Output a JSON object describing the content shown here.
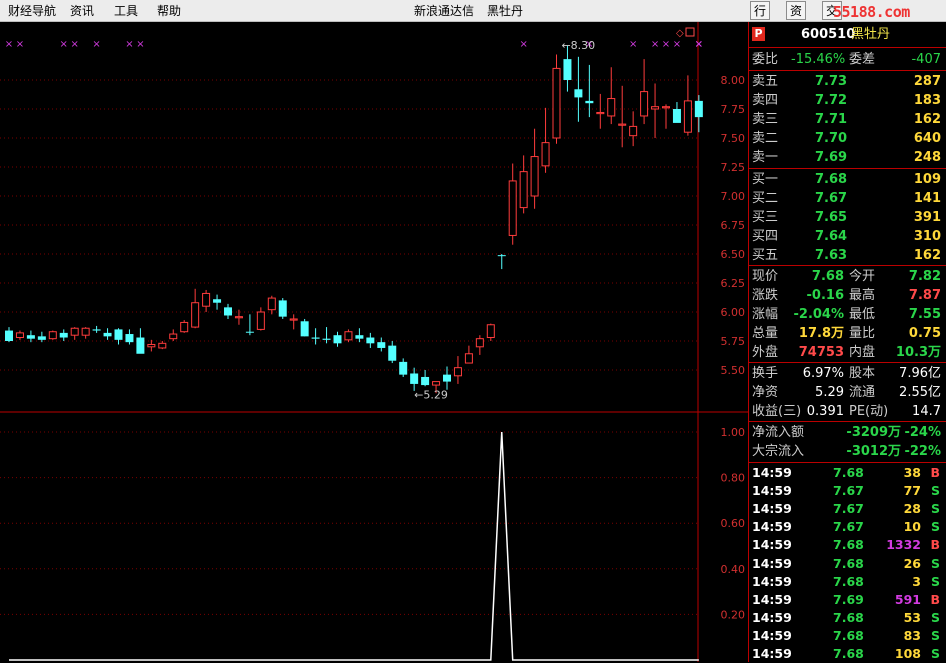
{
  "menu": {
    "items": [
      "财经导航",
      "资讯",
      "工具",
      "帮助"
    ],
    "title": "新浪通达信",
    "stock_name": "黑牡丹"
  },
  "tabs": [
    "行情",
    "资讯",
    "交易"
  ],
  "watermark": "55188.com",
  "panel": {
    "code": "600510",
    "name": "黑牡丹",
    "weibi": {
      "label": "委比",
      "value": "-15.46%",
      "label2": "委差",
      "value2": "-407"
    },
    "sells": [
      {
        "label": "卖五",
        "price": "7.73",
        "vol": "287"
      },
      {
        "label": "卖四",
        "price": "7.72",
        "vol": "183"
      },
      {
        "label": "卖三",
        "price": "7.71",
        "vol": "162"
      },
      {
        "label": "卖二",
        "price": "7.70",
        "vol": "640"
      },
      {
        "label": "卖一",
        "price": "7.69",
        "vol": "248"
      }
    ],
    "buys": [
      {
        "label": "买一",
        "price": "7.68",
        "vol": "109"
      },
      {
        "label": "买二",
        "price": "7.67",
        "vol": "141"
      },
      {
        "label": "买三",
        "price": "7.65",
        "vol": "391"
      },
      {
        "label": "买四",
        "price": "7.64",
        "vol": "310"
      },
      {
        "label": "买五",
        "price": "7.63",
        "vol": "162"
      }
    ],
    "quote": [
      {
        "l1": "现价",
        "v1": "7.68",
        "l2": "今开",
        "v2": "7.82"
      },
      {
        "l1": "涨跌",
        "v1": "-0.16",
        "l2": "最高",
        "v2": "7.87"
      },
      {
        "l1": "涨幅",
        "v1": "-2.04%",
        "l2": "最低",
        "v2": "7.55"
      },
      {
        "l1": "总量",
        "v1": "17.8万",
        "l2": "量比",
        "v2": "0.75"
      },
      {
        "l1": "外盘",
        "v1": "74753",
        "l2": "内盘",
        "v2": "10.3万"
      }
    ],
    "fund": [
      {
        "l1": "换手",
        "v1": "6.97%",
        "l2": "股本",
        "v2": "7.96亿"
      },
      {
        "l1": "净资",
        "v1": "5.29",
        "l2": "流通",
        "v2": "2.55亿"
      },
      {
        "l1": "收益(三)",
        "v1": "0.391",
        "l2": "PE(动)",
        "v2": "14.7"
      }
    ],
    "flow": [
      {
        "label": "净流入额",
        "value": "-3209万",
        "pct": "-24%"
      },
      {
        "label": "大宗流入",
        "value": "-3012万",
        "pct": "-22%"
      }
    ],
    "ticks": [
      {
        "time": "14:59",
        "price": "7.68",
        "vol": "38",
        "side": "B"
      },
      {
        "time": "14:59",
        "price": "7.67",
        "vol": "77",
        "side": "S"
      },
      {
        "time": "14:59",
        "price": "7.67",
        "vol": "28",
        "side": "S"
      },
      {
        "time": "14:59",
        "price": "7.67",
        "vol": "10",
        "side": "S"
      },
      {
        "time": "14:59",
        "price": "7.68",
        "vol": "1332",
        "side": "B"
      },
      {
        "time": "14:59",
        "price": "7.68",
        "vol": "26",
        "side": "S"
      },
      {
        "time": "14:59",
        "price": "7.68",
        "vol": "3",
        "side": "S"
      },
      {
        "time": "14:59",
        "price": "7.69",
        "vol": "591",
        "side": "B"
      },
      {
        "time": "14:59",
        "price": "7.68",
        "vol": "53",
        "side": "S"
      },
      {
        "time": "14:59",
        "price": "7.68",
        "vol": "83",
        "side": "S"
      },
      {
        "time": "14:59",
        "price": "7.68",
        "vol": "108",
        "side": "S"
      }
    ]
  },
  "chart_data": [
    {
      "type": "candlestick",
      "title": "",
      "ylim": [
        5.25,
        8.4
      ],
      "y_ticks": [
        "8.00",
        "7.75",
        "7.50",
        "7.25",
        "7.00",
        "6.75",
        "6.50",
        "6.25",
        "6.00",
        "5.75",
        "5.50"
      ],
      "annotations": [
        "8.30",
        "5.29"
      ],
      "colors": {
        "up": "#ff3c3c",
        "down": "#54ffff",
        "grid": "#7a0000",
        "marker": "#d23be0"
      },
      "ohlc": [
        [
          5.84,
          5.87,
          5.74,
          5.75
        ],
        [
          5.78,
          5.84,
          5.76,
          5.82
        ],
        [
          5.8,
          5.84,
          5.74,
          5.77
        ],
        [
          5.79,
          5.83,
          5.74,
          5.76
        ],
        [
          5.77,
          5.84,
          5.76,
          5.83
        ],
        [
          5.82,
          5.85,
          5.75,
          5.78
        ],
        [
          5.8,
          5.87,
          5.76,
          5.86
        ],
        [
          5.8,
          5.87,
          5.77,
          5.86
        ],
        [
          5.85,
          5.88,
          5.82,
          5.84
        ],
        [
          5.82,
          5.86,
          5.76,
          5.79
        ],
        [
          5.85,
          5.86,
          5.72,
          5.76
        ],
        [
          5.81,
          5.85,
          5.72,
          5.74
        ],
        [
          5.78,
          5.86,
          5.68,
          5.64
        ],
        [
          5.7,
          5.76,
          5.66,
          5.72
        ],
        [
          5.69,
          5.75,
          5.68,
          5.73
        ],
        [
          5.77,
          5.85,
          5.75,
          5.81
        ],
        [
          5.83,
          5.93,
          5.82,
          5.91
        ],
        [
          5.87,
          6.2,
          5.86,
          6.08
        ],
        [
          6.05,
          6.19,
          6.0,
          6.16
        ],
        [
          6.11,
          6.15,
          6.02,
          6.08
        ],
        [
          6.04,
          6.07,
          5.94,
          5.97
        ],
        [
          5.95,
          6.02,
          5.89,
          5.96
        ],
        [
          5.83,
          5.98,
          5.8,
          5.83
        ],
        [
          5.85,
          6.04,
          5.84,
          6.0
        ],
        [
          6.02,
          6.14,
          5.98,
          6.12
        ],
        [
          6.1,
          6.12,
          5.94,
          5.96
        ],
        [
          5.93,
          5.98,
          5.85,
          5.94
        ],
        [
          5.92,
          5.94,
          5.79,
          5.79
        ],
        [
          5.78,
          5.86,
          5.72,
          5.77
        ],
        [
          5.77,
          5.87,
          5.73,
          5.76
        ],
        [
          5.8,
          5.83,
          5.7,
          5.73
        ],
        [
          5.76,
          5.85,
          5.74,
          5.83
        ],
        [
          5.8,
          5.86,
          5.74,
          5.77
        ],
        [
          5.78,
          5.82,
          5.69,
          5.73
        ],
        [
          5.74,
          5.78,
          5.66,
          5.69
        ],
        [
          5.71,
          5.75,
          5.56,
          5.58
        ],
        [
          5.57,
          5.6,
          5.44,
          5.46
        ],
        [
          5.47,
          5.52,
          5.32,
          5.38
        ],
        [
          5.44,
          5.5,
          5.36,
          5.37
        ],
        [
          5.37,
          5.4,
          5.3,
          5.4
        ],
        [
          5.46,
          5.53,
          5.33,
          5.4
        ],
        [
          5.45,
          5.62,
          5.38,
          5.52
        ],
        [
          5.56,
          5.71,
          5.56,
          5.64
        ],
        [
          5.7,
          5.8,
          5.63,
          5.77
        ],
        [
          5.78,
          5.9,
          5.75,
          5.89
        ],
        [
          6.49,
          6.5,
          6.37,
          6.49
        ],
        [
          6.66,
          7.28,
          6.58,
          7.13
        ],
        [
          6.9,
          7.35,
          6.85,
          7.21
        ],
        [
          7.0,
          7.58,
          6.89,
          7.34
        ],
        [
          7.26,
          7.76,
          7.2,
          7.46
        ],
        [
          7.5,
          8.22,
          7.45,
          8.1
        ],
        [
          8.18,
          8.3,
          7.9,
          8.0
        ],
        [
          7.92,
          8.2,
          7.64,
          7.85
        ],
        [
          7.82,
          8.13,
          7.68,
          7.8
        ],
        [
          7.71,
          7.88,
          7.58,
          7.72
        ],
        [
          7.69,
          8.11,
          7.62,
          7.84
        ],
        [
          7.61,
          7.95,
          7.42,
          7.62
        ],
        [
          7.52,
          7.73,
          7.43,
          7.6
        ],
        [
          7.69,
          8.18,
          7.62,
          7.9
        ],
        [
          7.75,
          7.97,
          7.5,
          7.77
        ],
        [
          7.76,
          7.79,
          7.58,
          7.77
        ],
        [
          7.75,
          7.81,
          7.66,
          7.63
        ],
        [
          7.55,
          8.04,
          7.52,
          7.82
        ],
        [
          7.82,
          7.87,
          7.55,
          7.68
        ]
      ]
    },
    {
      "type": "line",
      "ylim": [
        0,
        1.0
      ],
      "y_ticks": [
        "1.00",
        "0.80",
        "0.60",
        "0.40",
        "0.20"
      ],
      "values": [
        0,
        0,
        0,
        0,
        0,
        0,
        0,
        0,
        0,
        0,
        0,
        0,
        0,
        0,
        0,
        0,
        0,
        0,
        0,
        0,
        0,
        0,
        0,
        0,
        0,
        0,
        0,
        0,
        0,
        0,
        0,
        0,
        0,
        0,
        0,
        0,
        0,
        0,
        0,
        0,
        0,
        0,
        0,
        0,
        0,
        1,
        0,
        0,
        0,
        0,
        0,
        0,
        0,
        0,
        0,
        0,
        0,
        0,
        0,
        0,
        0,
        0,
        0,
        0
      ]
    }
  ]
}
